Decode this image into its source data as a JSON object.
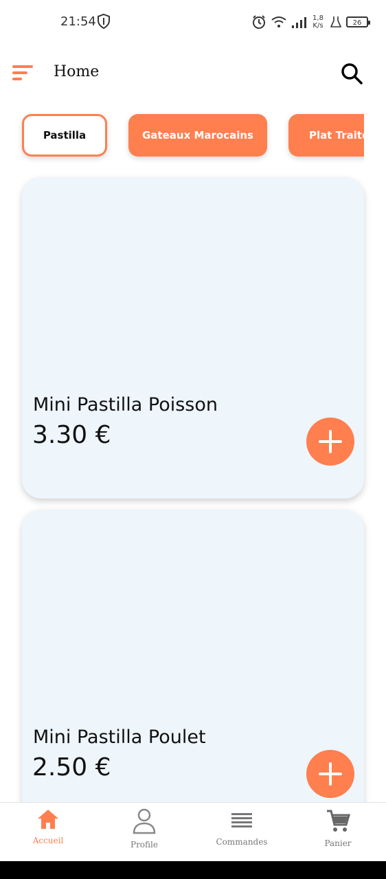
{
  "status_bar": {
    "time": "21:54",
    "net_speed_value": "1,8",
    "net_speed_unit": "K/s",
    "battery": "26"
  },
  "app_bar": {
    "title": "Home",
    "menu_icon": "sort-menu-icon",
    "search_icon": "search-icon"
  },
  "categories": [
    {
      "label": "Pastilla",
      "active": true
    },
    {
      "label": "Gateaux Marocains",
      "active": false
    },
    {
      "label": "Plat Traiteur",
      "active": false
    }
  ],
  "products": [
    {
      "name": "Mini Pastilla Poisson",
      "price": "3.30 €"
    },
    {
      "name": "Mini Pastilla Poulet",
      "price": "2.50 €"
    }
  ],
  "bottom_nav": [
    {
      "label": "Accueil",
      "icon": "home-icon",
      "active": true
    },
    {
      "label": "Profile",
      "icon": "person-icon",
      "active": false
    },
    {
      "label": "Commandes",
      "icon": "list-icon",
      "active": false
    },
    {
      "label": "Panier",
      "icon": "cart-icon",
      "active": false
    }
  ],
  "colors": {
    "accent": "#ff7f4f",
    "card_bg": "#eef5fb",
    "nav_inactive": "#777777"
  }
}
